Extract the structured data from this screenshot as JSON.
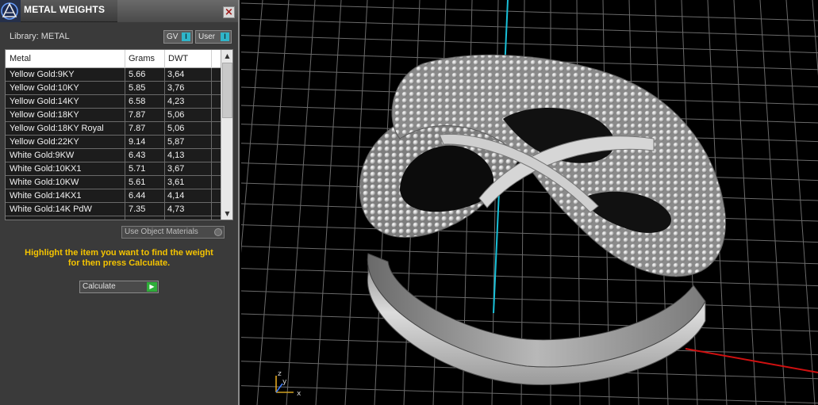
{
  "panel": {
    "title": "METAL WEIGHTS",
    "close_label": "×",
    "library_label": "Library: METAL",
    "toggles": [
      {
        "label": "GV",
        "indicator": "I"
      },
      {
        "label": "User",
        "indicator": "I"
      }
    ],
    "table": {
      "headers": [
        "Metal",
        "Grams",
        "DWT"
      ],
      "rows": [
        [
          "Yellow Gold:9KY",
          "5.66",
          "3,64"
        ],
        [
          "Yellow Gold:10KY",
          "5.85",
          "3,76"
        ],
        [
          "Yellow Gold:14KY",
          "6.58",
          "4,23"
        ],
        [
          "Yellow Gold:18KY",
          "7.87",
          "5,06"
        ],
        [
          "Yellow Gold:18KY Royal",
          "7.87",
          "5,06"
        ],
        [
          "Yellow Gold:22KY",
          "9.14",
          "5,87"
        ],
        [
          "White Gold:9KW",
          "6.43",
          "4,13"
        ],
        [
          "White Gold:10KX1",
          "5.71",
          "3,67"
        ],
        [
          "White Gold:10KW",
          "5.61",
          "3,61"
        ],
        [
          "White Gold:14KX1",
          "6.44",
          "4,14"
        ],
        [
          "White Gold:14K PdW",
          "7.35",
          "4,73"
        ]
      ]
    },
    "use_object_materials_label": "Use Object Materials",
    "instruction_line1": "Highlight the item you want to find the weight",
    "instruction_line2": "for then press Calculate.",
    "calculate_label": "Calculate"
  },
  "colors": {
    "instruction": "#f5c400",
    "toggle_indicator": "#2fb5c9",
    "calculate_go": "#2fae3a",
    "axis_x": "#d01010",
    "axis_y": "#18c0d8"
  },
  "viewport": {
    "gizmo_labels": [
      "z",
      "y",
      "x"
    ],
    "subject": "ring-model"
  }
}
